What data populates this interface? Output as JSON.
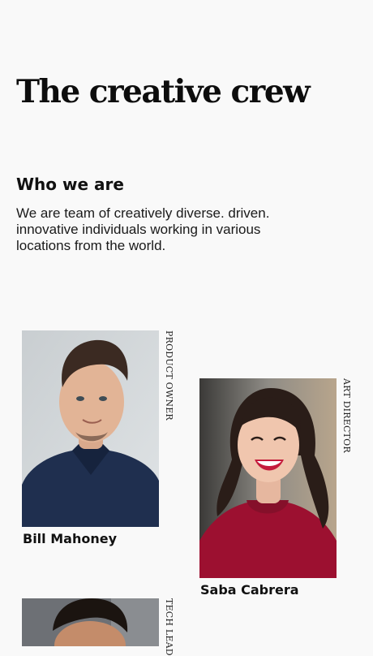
{
  "page": {
    "title": "The creative crew"
  },
  "about": {
    "heading": "Who we are",
    "body": "We are team of creatively diverse. driven. innovative individuals working in various locations from the world."
  },
  "team": [
    {
      "name": "Bill Mahoney",
      "role": "PRODUCT OWNER"
    },
    {
      "name": "Saba Cabrera",
      "role": "ART DIRECTOR"
    },
    {
      "name": "",
      "role": "TECH LEAD"
    }
  ],
  "colors": {
    "background": "#f9f9f9",
    "text": "#111111"
  }
}
